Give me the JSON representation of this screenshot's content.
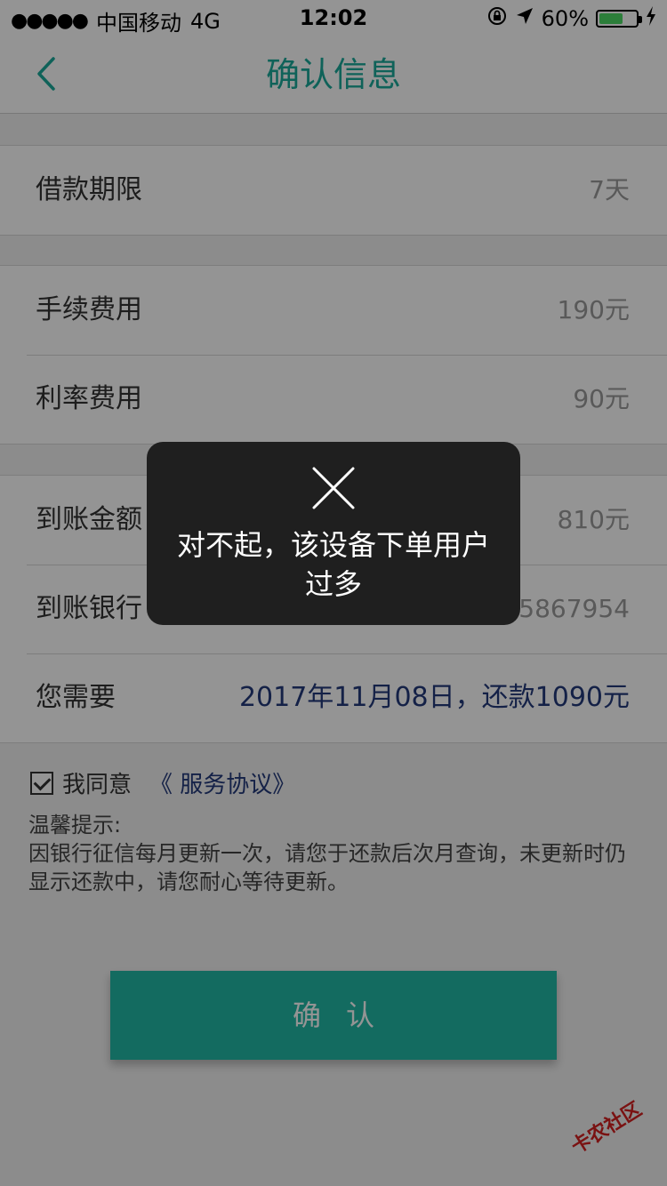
{
  "status_bar": {
    "signal_dots": "●●●●●",
    "carrier": "中国移动",
    "network": "4G",
    "time": "12:02",
    "battery_percent": "60%",
    "battery_level": 0.6,
    "icons": [
      "signal-icon",
      "lock-rotation-icon",
      "location-arrow-icon",
      "battery-icon",
      "charging-icon"
    ]
  },
  "nav": {
    "title": "确认信息",
    "back_icon": "chevron-left-icon",
    "accent_color": "#1aa99a"
  },
  "sections": [
    {
      "rows": [
        {
          "label": "借款期限",
          "value": "7天"
        }
      ]
    },
    {
      "rows": [
        {
          "label": "手续费用",
          "value": "190元"
        },
        {
          "label": "利率费用",
          "value": "90元"
        }
      ]
    },
    {
      "rows": [
        {
          "label": "到账金额",
          "value": "810元"
        },
        {
          "label": "到账银行",
          "value": "05867954"
        },
        {
          "label": "您需要",
          "value": "2017年11月08日，还款1090元"
        }
      ]
    }
  ],
  "agreement": {
    "checked": true,
    "text": "我同意",
    "link": "《 服务协议》"
  },
  "tips": {
    "title": "温馨提示:",
    "body": "因银行征信每月更新一次，请您于还款后次月查询，未更新时仍显示还款中，请您耐心等待更新。"
  },
  "confirm_button": {
    "label": "确认",
    "color": "#21b8a5"
  },
  "toast": {
    "icon": "close-x-icon",
    "message": "对不起，该设备下单用户过多"
  },
  "watermark": {
    "text": "卡农社区"
  }
}
